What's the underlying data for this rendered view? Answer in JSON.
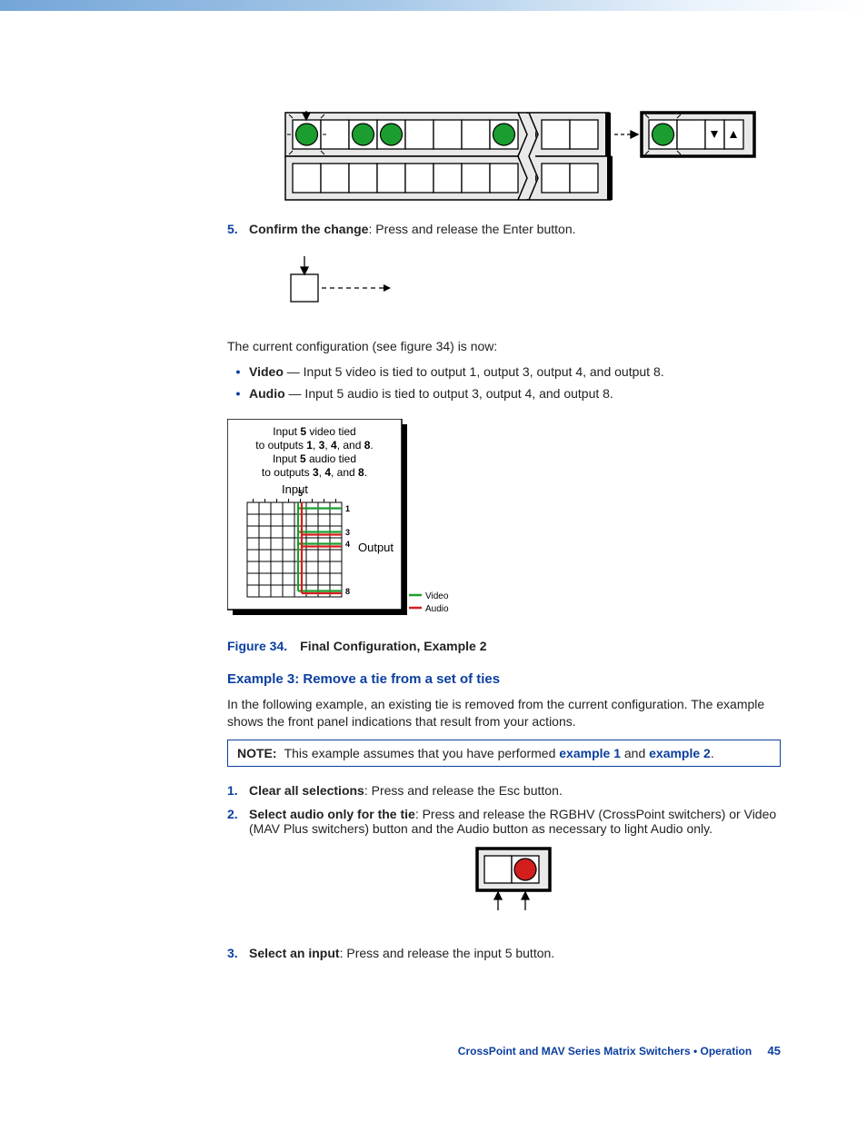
{
  "step5": {
    "num": "5.",
    "bold": "Confirm the change",
    "rest": ": Press and release the Enter button."
  },
  "config_intro": "The current configuration (see figure 34) is now:",
  "bullets": {
    "video_b": "Video",
    "video_r": " — Input 5 video is tied to output 1, output 3, output 4, and output 8.",
    "audio_b": "Audio",
    "audio_r": " — Input 5 audio is tied to output 3, output 4, and output 8."
  },
  "fig34_box": {
    "l1a": "Input ",
    "l1b": "5",
    "l1c": " video tied",
    "l2a": "to outputs ",
    "l2b": "1",
    "l2c": ", ",
    "l2d": "3",
    "l2e": ", ",
    "l2f": "4",
    "l2g": ", and ",
    "l2h": "8",
    "l2i": ".",
    "l3a": "Input ",
    "l3b": "5",
    "l3c": " audio tied",
    "l4a": "to outputs ",
    "l4b": "3",
    "l4c": ", ",
    "l4d": "4",
    "l4e": ", and ",
    "l4f": "8",
    "l4g": ".",
    "input": "Input",
    "output": "Output",
    "five": "5",
    "o1": "1",
    "o3": "3",
    "o4": "4",
    "o8": "8",
    "lg_video": "Video",
    "lg_audio": "Audio"
  },
  "fig34_cap": {
    "lbl": "Figure 34.",
    "txt": "Final Configuration, Example 2"
  },
  "ex3_heading": "Example 3: Remove a tie from a set of ties",
  "ex3_para": "In the following example, an existing tie is removed from the current configuration. The example shows the front panel indications that result from your actions.",
  "note": {
    "n": "NOTE:",
    "t1": "This example assumes that you have performed ",
    "l1": "example 1",
    "t2": " and ",
    "l2": "example 2",
    "t3": "."
  },
  "steps": {
    "s1n": "1.",
    "s1b": "Clear all selections",
    "s1r": ": Press and release the Esc button.",
    "s2n": "2.",
    "s2b": "Select audio only for the tie",
    "s2r": ": Press and release the RGBHV (CrossPoint switchers) or Video (MAV Plus switchers) button and the Audio button as necessary to light Audio only.",
    "s3n": "3.",
    "s3b": "Select an input",
    "s3r": ": Press and release the input 5 button."
  },
  "footer": {
    "title": "CrossPoint and MAV Series Matrix Switchers • Operation",
    "page": "45"
  }
}
